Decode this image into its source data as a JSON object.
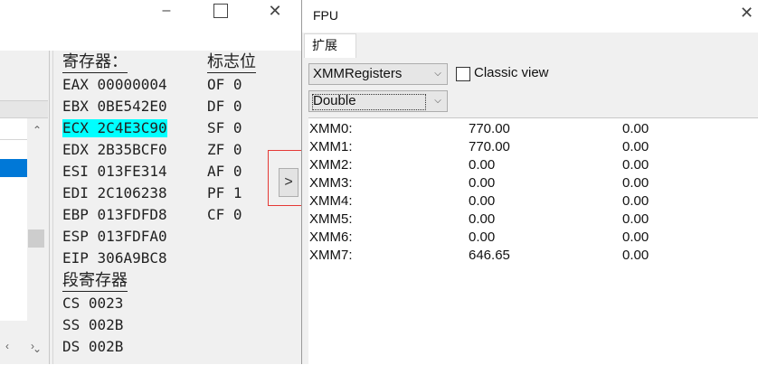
{
  "left_window": {
    "registers_heading": "寄存器：",
    "flags_heading": "标志位",
    "segment_heading": "段寄存器",
    "registers": [
      {
        "name": "EAX",
        "value": "00000004"
      },
      {
        "name": "EBX",
        "value": "0BE542E0"
      },
      {
        "name": "ECX",
        "value": "2C4E3C90"
      },
      {
        "name": "EDX",
        "value": "2B35BCF0"
      },
      {
        "name": "ESI",
        "value": "013FE314"
      },
      {
        "name": "EDI",
        "value": "2C106238"
      },
      {
        "name": "EBP",
        "value": "013FDFD8"
      },
      {
        "name": "ESP",
        "value": "013FDFA0"
      },
      {
        "name": "EIP",
        "value": "306A9BC8"
      }
    ],
    "flags": [
      {
        "name": "OF",
        "value": "0"
      },
      {
        "name": "DF",
        "value": "0"
      },
      {
        "name": "SF",
        "value": "0"
      },
      {
        "name": "ZF",
        "value": "0"
      },
      {
        "name": "AF",
        "value": "0"
      },
      {
        "name": "PF",
        "value": "1"
      },
      {
        "name": "CF",
        "value": "0"
      }
    ],
    "segments": [
      {
        "name": "CS",
        "value": "0023"
      },
      {
        "name": "SS",
        "value": "002B"
      },
      {
        "name": "DS",
        "value": "002B"
      }
    ],
    "expand_button_label": ">",
    "highlight_color": "#00ffff"
  },
  "fpu_window": {
    "title": "FPU",
    "tab_label": "扩展",
    "register_set_value": "XMMRegisters",
    "format_value": "Double",
    "classic_view_label": "Classic view",
    "classic_view_checked": false,
    "xmm_registers": [
      {
        "name": "XMM0:",
        "v1": "770.00",
        "v2": "0.00"
      },
      {
        "name": "XMM1:",
        "v1": "770.00",
        "v2": "0.00"
      },
      {
        "name": "XMM2:",
        "v1": "0.00",
        "v2": "0.00"
      },
      {
        "name": "XMM3:",
        "v1": "0.00",
        "v2": "0.00"
      },
      {
        "name": "XMM4:",
        "v1": "0.00",
        "v2": "0.00"
      },
      {
        "name": "XMM5:",
        "v1": "0.00",
        "v2": "0.00"
      },
      {
        "name": "XMM6:",
        "v1": "0.00",
        "v2": "0.00"
      },
      {
        "name": "XMM7:",
        "v1": "646.65",
        "v2": "0.00"
      }
    ]
  },
  "icons": {
    "minimize": "minimize-icon",
    "maximize": "maximize-icon",
    "close": "close-icon",
    "dropdown": "chevron-down-icon",
    "scroll_up": "chevron-up-icon",
    "scroll_down": "chevron-down-icon",
    "scroll_left": "chevron-left-icon",
    "scroll_right": "chevron-right-icon"
  }
}
